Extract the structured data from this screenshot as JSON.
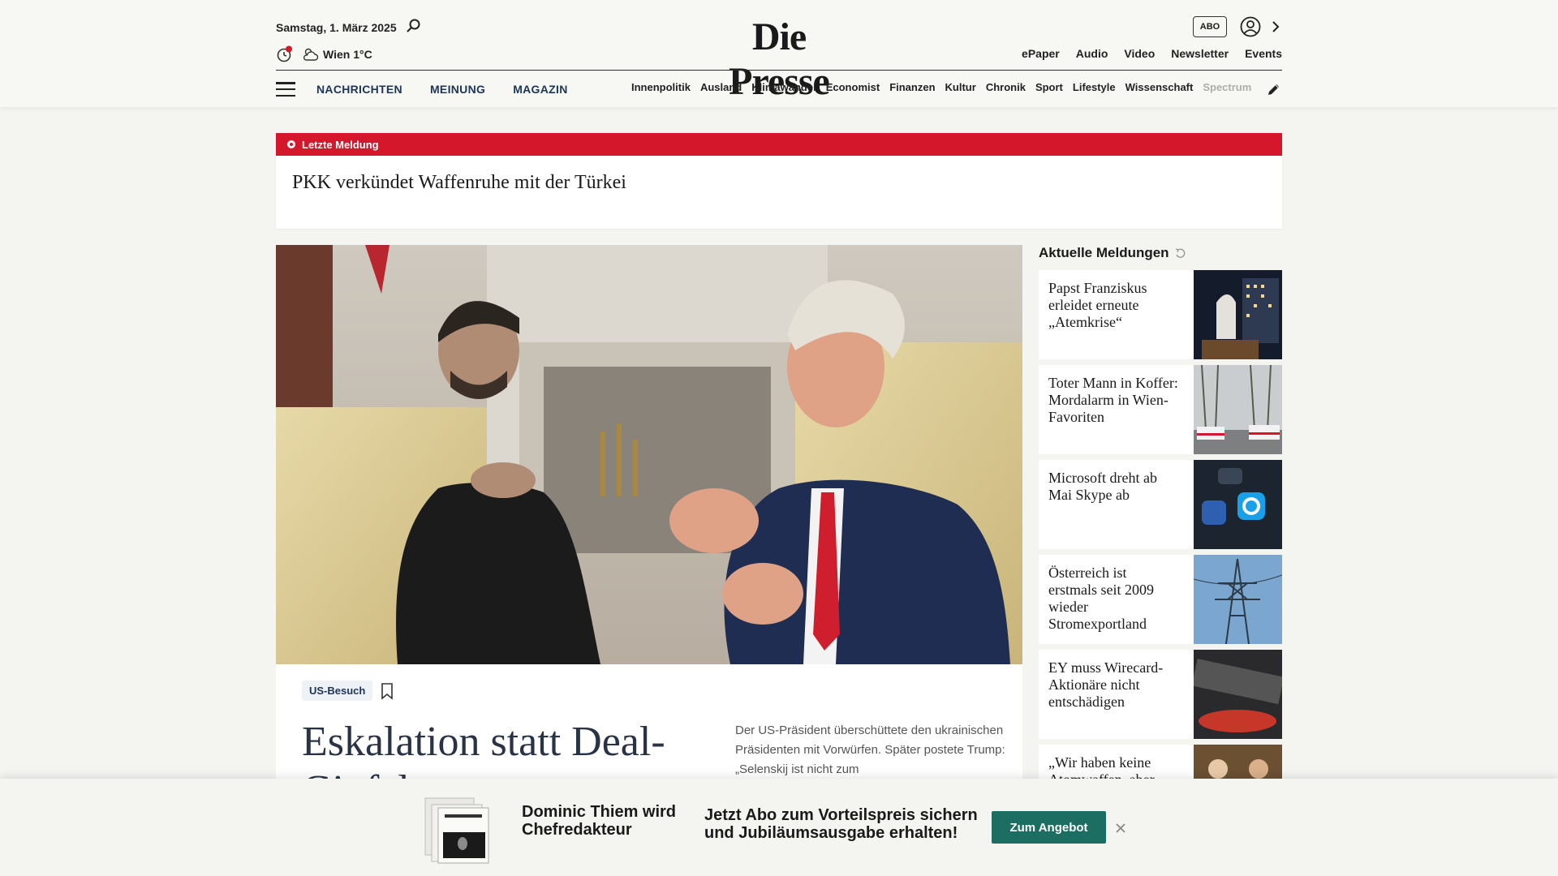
{
  "header": {
    "date": "Samstag, 1. März 2025",
    "weather": "Wien 1°C",
    "logo": "Die Presse",
    "abo_label": "ABO",
    "top_links": [
      "ePaper",
      "Audio",
      "Video",
      "Newsletter",
      "Events"
    ],
    "main_nav": [
      "NACHRICHTEN",
      "MEINUNG",
      "MAGAZIN"
    ],
    "sub_nav": [
      "Innenpolitik",
      "Ausland",
      "Klimawandel",
      "Economist",
      "Finanzen",
      "Kultur",
      "Chronik",
      "Sport",
      "Lifestyle",
      "Wissenschaft",
      "Spectrum"
    ]
  },
  "breaking": {
    "label": "Letzte Meldung",
    "headline": "PKK verkündet Waffenruhe mit der Türkei"
  },
  "main_article": {
    "tag": "US-Besuch",
    "headline": "Eskalation statt Deal-Gipfel",
    "teaser": "Der US-Präsident überschüttete den ukrainischen Präsidenten mit Vorwürfen. Später postete Trump: „Selenskij ist nicht zum"
  },
  "sidebar": {
    "title": "Aktuelle Meldungen",
    "items": [
      {
        "headline": "Papst Franziskus erleidet erneute „Atemkrise“"
      },
      {
        "headline": "Toter Mann in Koffer: Mordalarm in Wien-Favoriten"
      },
      {
        "headline": "Microsoft dreht ab Mai Skype ab"
      },
      {
        "headline": "Österreich ist erstmals seit 2009 wieder Stromexportland"
      },
      {
        "headline": "EY muss Wirecard-Aktionäre nicht entschädigen"
      },
      {
        "headline": "„Wir haben keine Atomwaffen, aber"
      }
    ]
  },
  "promo": {
    "name": "Dominic Thiem wird Chefredakteur",
    "offer": "Jetzt Abo zum Vorteilspreis sichern und Jubiläumsausgabe erhalten!",
    "button": "Zum Angebot"
  },
  "colors": {
    "breaking_red": "#d4172a",
    "nav_blue": "#1d3557",
    "promo_button": "#1d6e62"
  }
}
